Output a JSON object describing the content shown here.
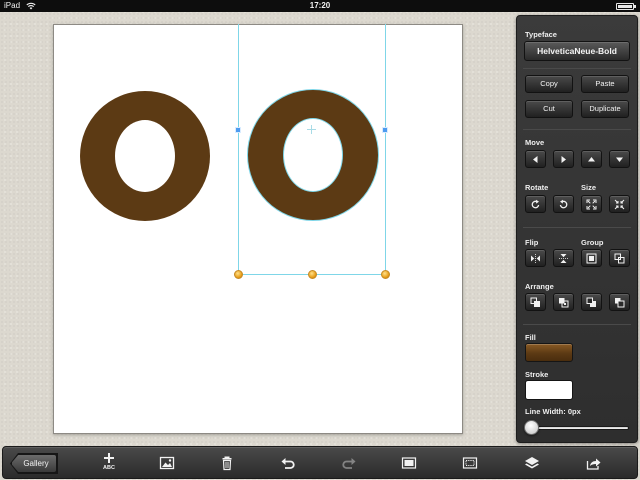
{
  "status_bar": {
    "carrier": "iPad",
    "time": "17:20",
    "battery_level": 1.0
  },
  "canvas": {
    "glyphs": [
      {
        "char": "O",
        "color": "#5c3a14",
        "selected": false
      },
      {
        "char": "O",
        "color": "#5c3a14",
        "selected": true
      }
    ],
    "selection_color": "#7fd6e8"
  },
  "panel": {
    "typeface_label": "Typeface",
    "typeface_value": "HelveticaNeue-Bold",
    "copy": "Copy",
    "paste": "Paste",
    "cut": "Cut",
    "duplicate": "Duplicate",
    "move_label": "Move",
    "rotate_label": "Rotate",
    "size_label": "Size",
    "flip_label": "Flip",
    "group_label": "Group",
    "arrange_label": "Arrange",
    "fill_label": "Fill",
    "fill_color": "#5c3a14",
    "stroke_label": "Stroke",
    "stroke_color": "#ffffff",
    "line_width_label": "Line Width: 0px",
    "line_width_value": 0
  },
  "toolbar": {
    "gallery": "Gallery",
    "add_text_caption": "ABC",
    "icons": [
      "add-text-icon",
      "add-image-icon",
      "trash-icon",
      "undo-icon",
      "redo-icon",
      "canvas-background-icon",
      "frame-icon",
      "layers-icon",
      "share-icon"
    ]
  }
}
